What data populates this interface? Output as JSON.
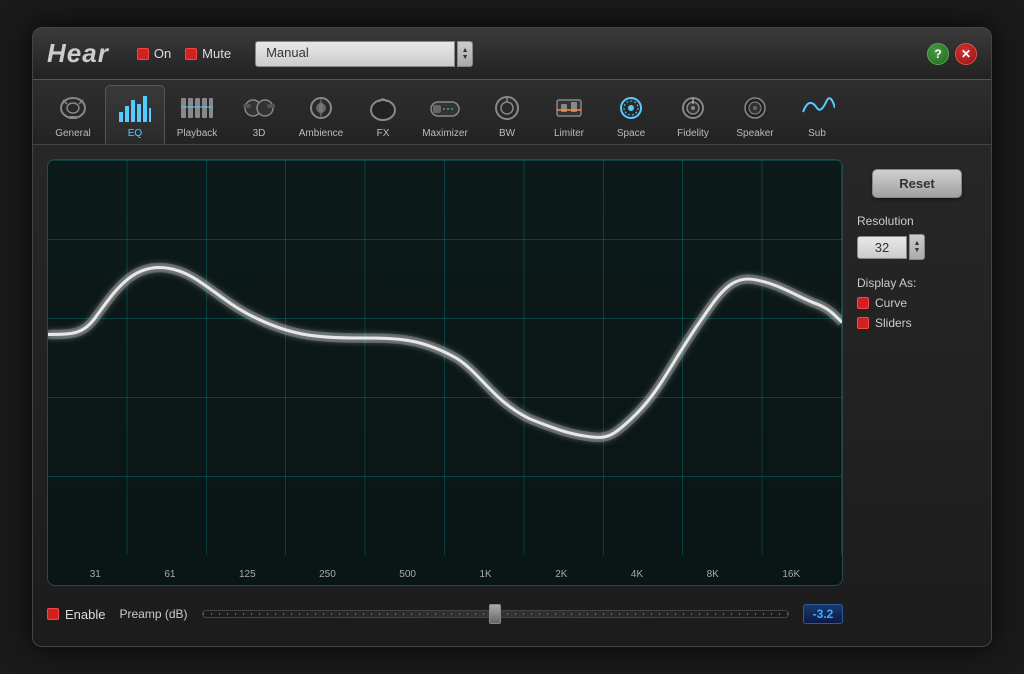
{
  "app": {
    "title": "Hear",
    "on_label": "On",
    "mute_label": "Mute",
    "preset_value": "Manual",
    "help_icon": "?",
    "close_icon": "✕"
  },
  "tabs": [
    {
      "id": "general",
      "label": "General",
      "active": false
    },
    {
      "id": "eq",
      "label": "EQ",
      "active": true
    },
    {
      "id": "playback",
      "label": "Playback",
      "active": false
    },
    {
      "id": "3d",
      "label": "3D",
      "active": false
    },
    {
      "id": "ambience",
      "label": "Ambience",
      "active": false
    },
    {
      "id": "fx",
      "label": "FX",
      "active": false
    },
    {
      "id": "maximizer",
      "label": "Maximizer",
      "active": false
    },
    {
      "id": "bw",
      "label": "BW",
      "active": false
    },
    {
      "id": "limiter",
      "label": "Limiter",
      "active": false
    },
    {
      "id": "space",
      "label": "Space",
      "active": false
    },
    {
      "id": "fidelity",
      "label": "Fidelity",
      "active": false
    },
    {
      "id": "speaker",
      "label": "Speaker",
      "active": false
    },
    {
      "id": "sub",
      "label": "Sub",
      "active": false
    }
  ],
  "eq": {
    "freq_labels": [
      "31",
      "61",
      "125",
      "250",
      "500",
      "1K",
      "2K",
      "4K",
      "8K",
      "16K"
    ],
    "enable_label": "Enable",
    "preamp_label": "Preamp (dB)",
    "preamp_value": "-3.2",
    "reset_label": "Reset",
    "resolution_label": "Resolution",
    "resolution_value": "32",
    "display_as_label": "Display As:",
    "curve_label": "Curve",
    "sliders_label": "Sliders"
  }
}
